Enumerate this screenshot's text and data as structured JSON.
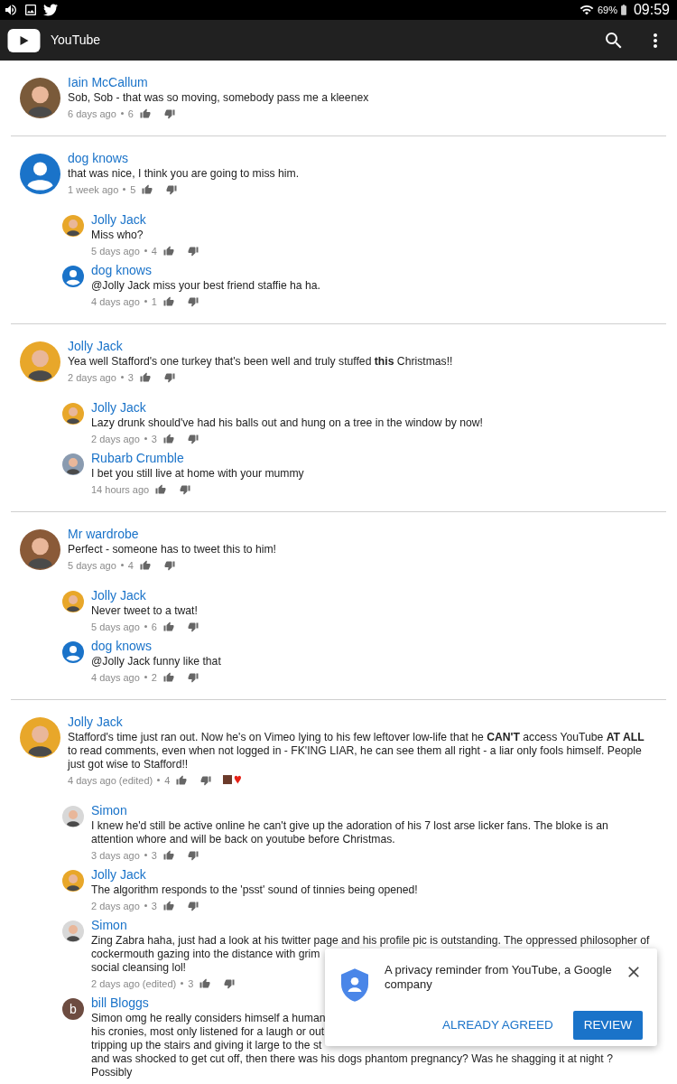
{
  "status_bar": {
    "battery": "69%",
    "time": "09:59"
  },
  "app_bar": {
    "title": "YouTube"
  },
  "threads": [
    {
      "comment": {
        "author": "Iain McCallum",
        "avatar": {
          "kind": "photo",
          "color": "#7a5a3a"
        },
        "lines": [
          "Sob, Sob - that was so moving, somebody pass me a kleenex"
        ],
        "time": "6 days ago",
        "likes": "6",
        "hearted": false
      }
    },
    {
      "comment": {
        "author": "dog knows",
        "avatar": {
          "kind": "default",
          "color": "#1a73c9"
        },
        "lines": [
          "that was nice, I think you are going to miss him."
        ],
        "time": "1 week ago",
        "likes": "5",
        "hearted": false
      },
      "replies": [
        {
          "author": "Jolly Jack",
          "avatar": {
            "kind": "photo",
            "color": "#e8a72a"
          },
          "lines": [
            "Miss who?"
          ],
          "time": "5 days ago",
          "likes": "4",
          "hearted": false
        },
        {
          "author": "dog knows",
          "avatar": {
            "kind": "default",
            "color": "#1a73c9"
          },
          "lines": [
            "@Jolly Jack miss your best friend staffie ha ha."
          ],
          "time": "4 days ago",
          "likes": "1",
          "hearted": false
        }
      ]
    },
    {
      "comment": {
        "author": "Jolly Jack",
        "avatar": {
          "kind": "photo",
          "color": "#e8a72a"
        },
        "lines": [
          "Yea well Stafford's one turkey that's been well and truly stuffed **this** Christmas!!"
        ],
        "time": "2 days ago",
        "likes": "3",
        "hearted": false
      },
      "replies": [
        {
          "author": "Jolly Jack",
          "avatar": {
            "kind": "photo",
            "color": "#e8a72a"
          },
          "lines": [
            "Lazy drunk should've had his balls out and hung on a tree in the window by now!"
          ],
          "time": "2 days ago",
          "likes": "3",
          "hearted": false
        },
        {
          "author": "Rubarb Crumble",
          "avatar": {
            "kind": "photo",
            "color": "#8a9bb0"
          },
          "lines": [
            "I bet you still live at home with your mummy"
          ],
          "time": "14 hours ago",
          "hearted": false
        }
      ]
    },
    {
      "comment": {
        "author": "Mr wardrobe",
        "avatar": {
          "kind": "photo",
          "color": "#8a5a38"
        },
        "lines": [
          "Perfect - someone has to tweet this to him!"
        ],
        "time": "5 days ago",
        "likes": "4",
        "hearted": false
      },
      "replies": [
        {
          "author": "Jolly Jack",
          "avatar": {
            "kind": "photo",
            "color": "#e8a72a"
          },
          "lines": [
            "Never tweet to a twat!"
          ],
          "time": "5 days ago",
          "likes": "6",
          "hearted": false
        },
        {
          "author": "dog knows",
          "avatar": {
            "kind": "default",
            "color": "#1a73c9"
          },
          "lines": [
            "@Jolly Jack funny like that"
          ],
          "time": "4 days ago",
          "likes": "2",
          "hearted": false
        }
      ]
    },
    {
      "comment": {
        "author": "Jolly Jack",
        "avatar": {
          "kind": "photo",
          "color": "#e8a72a"
        },
        "lines": [
          "Stafford's time just ran out.  Now he's on Vimeo lying to his few leftover low-life that he **CAN'T** access YouTube **AT ALL**",
          "to read comments, even when not logged in - FK'ING LIAR, he can see them all right - a liar only fools himself.  People",
          "just got wise to Stafford!!"
        ],
        "time": "4 days ago (edited)",
        "likes": "4",
        "hearted": true
      },
      "replies": [
        {
          "author": "Simon",
          "avatar": {
            "kind": "photo",
            "color": "#d8d8d8"
          },
          "lines": [
            "I knew he'd still be active online he can't give up the adoration of his 7 lost arse licker fans. The bloke is an",
            "attention whore and will be back on youtube before Christmas."
          ],
          "time": "3 days ago",
          "likes": "3",
          "hearted": false
        },
        {
          "author": "Jolly Jack",
          "avatar": {
            "kind": "photo",
            "color": "#e8a72a"
          },
          "lines": [
            "The algorithm responds to the 'psst' sound of tinnies being opened!"
          ],
          "time": "2 days ago",
          "likes": "3",
          "hearted": false
        },
        {
          "author": "Simon",
          "avatar": {
            "kind": "photo",
            "color": "#d8d8d8"
          },
          "lines": [
            "Zing Zabra haha, just had a look at his twitter page and his profile pic is outstanding. The oppressed philosopher of",
            "cockermouth gazing into the distance with grim",
            "social cleansing lol!"
          ],
          "time": "2 days ago (edited)",
          "likes": "3",
          "hearted": false
        },
        {
          "author": "bill Bloggs",
          "avatar": {
            "kind": "letter",
            "color": "#6d4c41",
            "letter": "b"
          },
          "lines": [
            "Simon omg he really considers himself a human",
            "his cronies, most only listened for a laugh or out",
            "tripping up the stairs and giving it large to the st",
            "and was shocked to get cut off, then there was his dogs phantom pregnancy? Was he shagging it at night ?",
            "Possibly"
          ]
        }
      ]
    }
  ],
  "privacy_popup": {
    "message": "A privacy reminder from YouTube, a Google company",
    "buttons": [
      {
        "label": "ALREADY AGREED",
        "kind": "text"
      },
      {
        "label": "REVIEW",
        "kind": "filled"
      }
    ]
  }
}
